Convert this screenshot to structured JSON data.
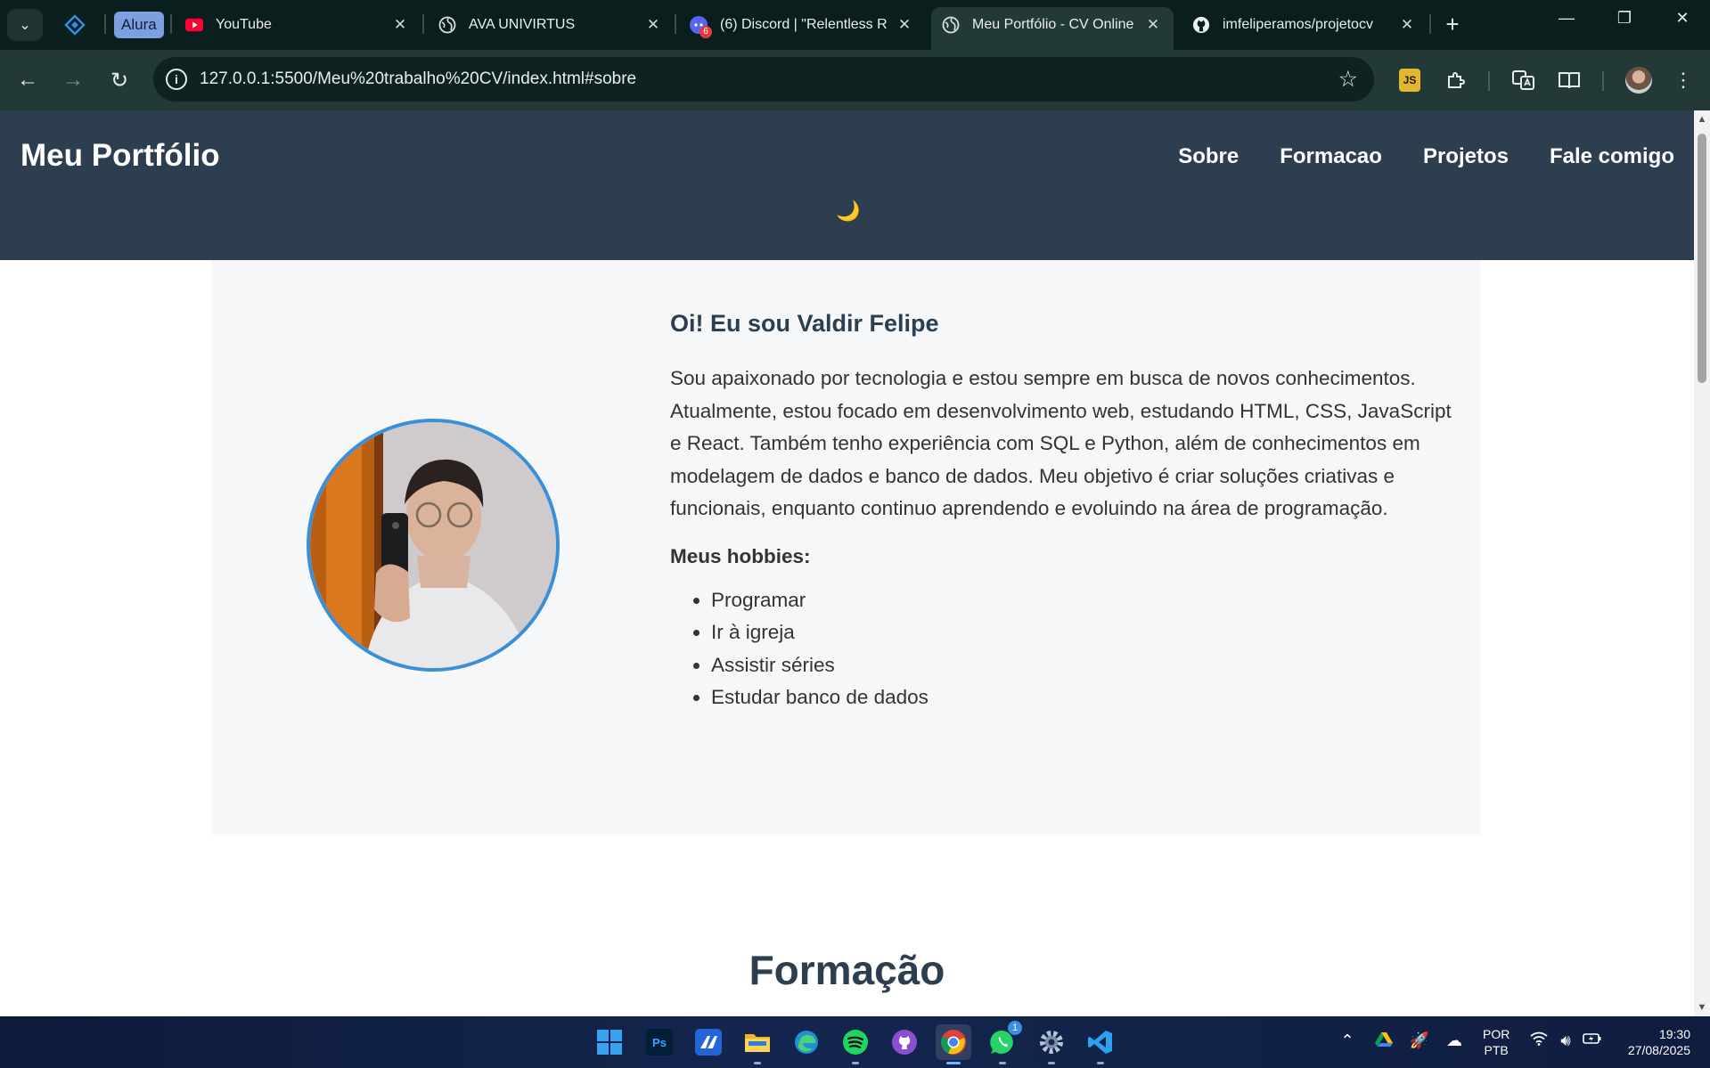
{
  "browser": {
    "pinned": {
      "alura_label": "Alura"
    },
    "tabs": [
      {
        "title": "YouTube"
      },
      {
        "title": "AVA UNIVIRTUS"
      },
      {
        "title": "(6) Discord | \"Relentless R",
        "badge": "6"
      },
      {
        "title": "Meu Portfólio - CV Online",
        "active": true
      },
      {
        "title": "imfeliperamos/projetocv"
      }
    ],
    "url": "127.0.0.1:5500/Meu%20trabalho%20CV/index.html#sobre",
    "ext_js_label": "JS"
  },
  "site": {
    "logo": "Meu Portfólio",
    "nav": [
      "Sobre",
      "Formacao",
      "Projetos",
      "Fale comigo"
    ],
    "theme_toggle": "🌙"
  },
  "about": {
    "heading": "Oi! Eu sou Valdir Felipe",
    "bio": "Sou apaixonado por tecnologia e estou sempre em busca de novos conhecimentos. Atualmente, estou focado em desenvolvimento web, estudando HTML, CSS, JavaScript e React. Também tenho experiência com SQL e Python, além de conhecimentos em modelagem de dados e banco de dados. Meu objetivo é criar soluções criativas e funcionais, enquanto continuo aprendendo e evoluindo na área de programação.",
    "hobbies_title": "Meus hobbies:",
    "hobbies": [
      "Programar",
      "Ir à igreja",
      "Assistir séries",
      "Estudar banco de dados"
    ]
  },
  "next_section_title": "Formação",
  "taskbar": {
    "whatsapp_badge": "1",
    "lang_line1": "POR",
    "lang_line2": "PTB",
    "time": "19:30",
    "date": "27/08/2025"
  },
  "colors": {
    "header_bg": "#2c3e50",
    "avatar_border": "#3a8fd9",
    "section_bg": "#f6f7f9"
  }
}
